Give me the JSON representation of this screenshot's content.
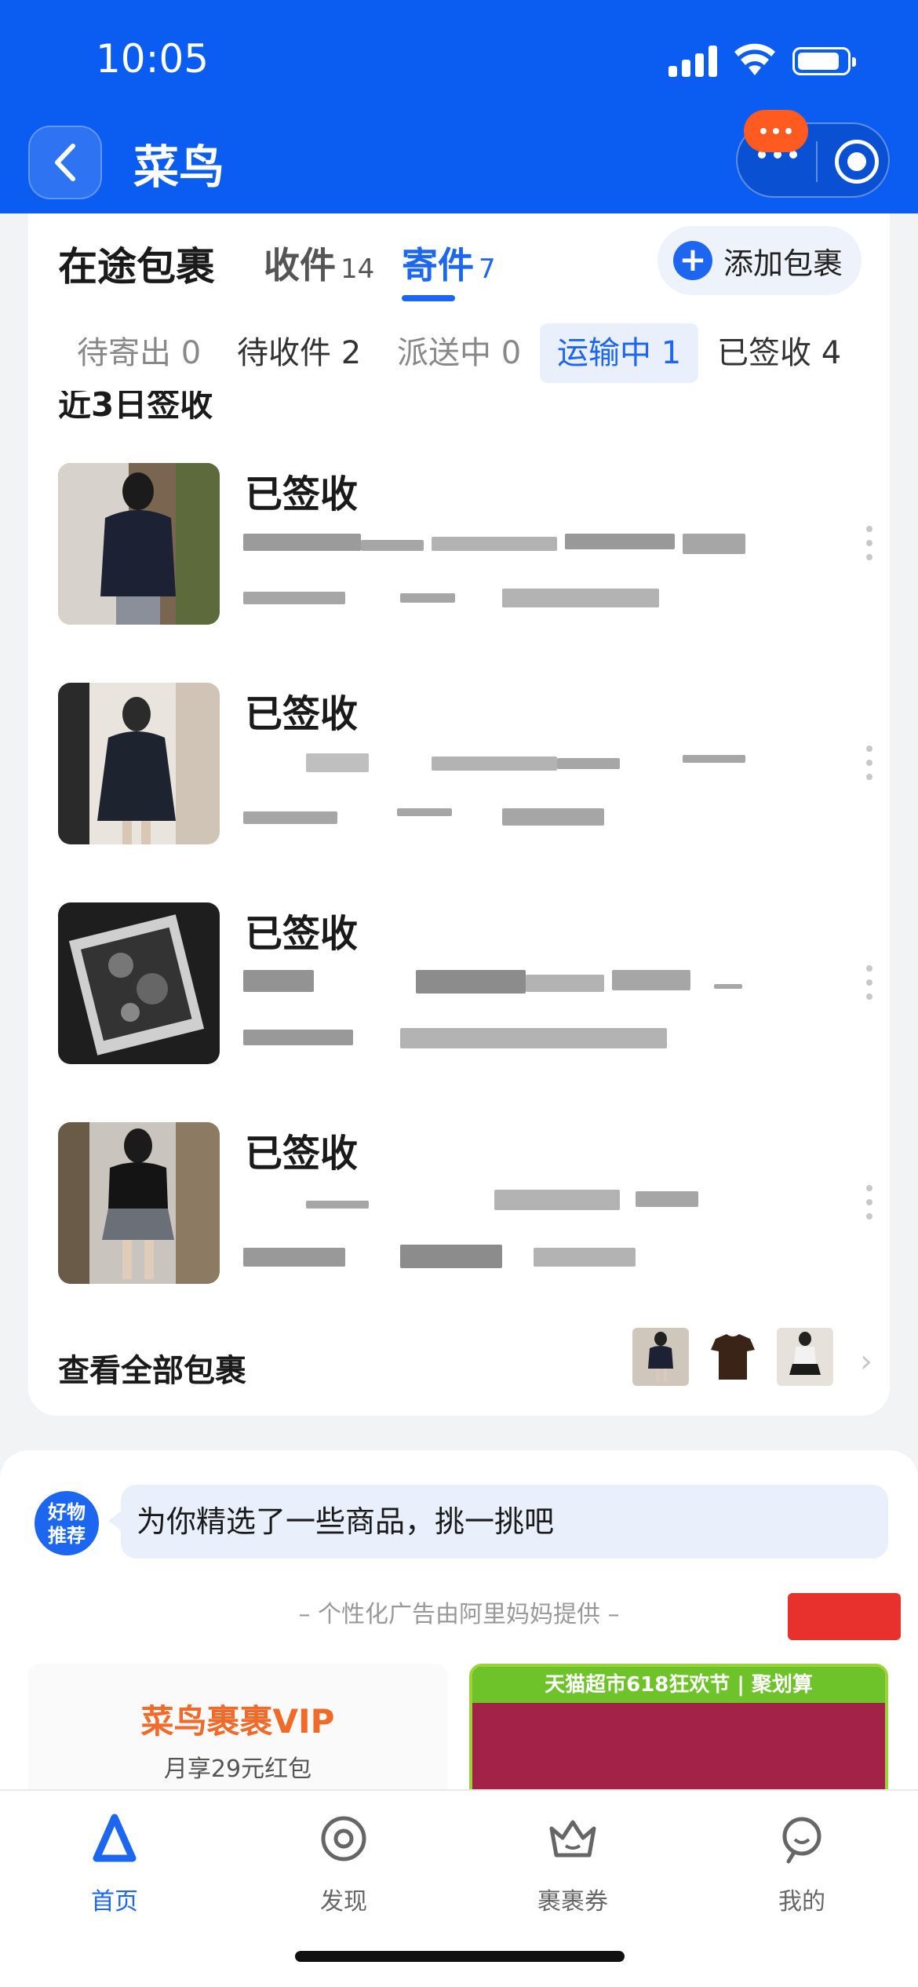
{
  "status_bar": {
    "time": "10:05"
  },
  "nav": {
    "title": "菜鸟"
  },
  "tabs": {
    "main": "在途包裹",
    "receive_label": "收件",
    "receive_count": "14",
    "send_label": "寄件",
    "send_count": "7",
    "add_label": "添加包裹"
  },
  "subtabs": [
    "待寄出 0",
    "待收件 2",
    "派送中 0",
    "运输中 1",
    "已签收 4"
  ],
  "section_title": "近3日签收",
  "packages": [
    {
      "status": "已签收"
    },
    {
      "status": "已签收"
    },
    {
      "status": "已签收"
    },
    {
      "status": "已签收"
    }
  ],
  "view_all": {
    "label": "查看全部包裹"
  },
  "recommend": {
    "badge_line1": "好物",
    "badge_line2": "推荐",
    "bubble": "为你精选了一些商品，挑一挑吧",
    "ad_note": "– 个性化广告由阿里妈妈提供 –",
    "vip_title": "菜鸟裹裹VIP",
    "vip_sub": "月享29元红包",
    "tmall_banner": "天猫超市618狂欢节 | 聚划算"
  },
  "tabbar": [
    {
      "label": "首页",
      "icon": "cainiao-logo-icon",
      "active": true
    },
    {
      "label": "发现",
      "icon": "discover-icon",
      "active": false
    },
    {
      "label": "裹裹券",
      "icon": "crown-coupon-icon",
      "active": false
    },
    {
      "label": "我的",
      "icon": "profile-icon",
      "active": false
    }
  ],
  "colors": {
    "brand_blue": "#0b5cf0",
    "accent_blue": "#1c66f0",
    "vip_orange": "#f06a2a"
  }
}
